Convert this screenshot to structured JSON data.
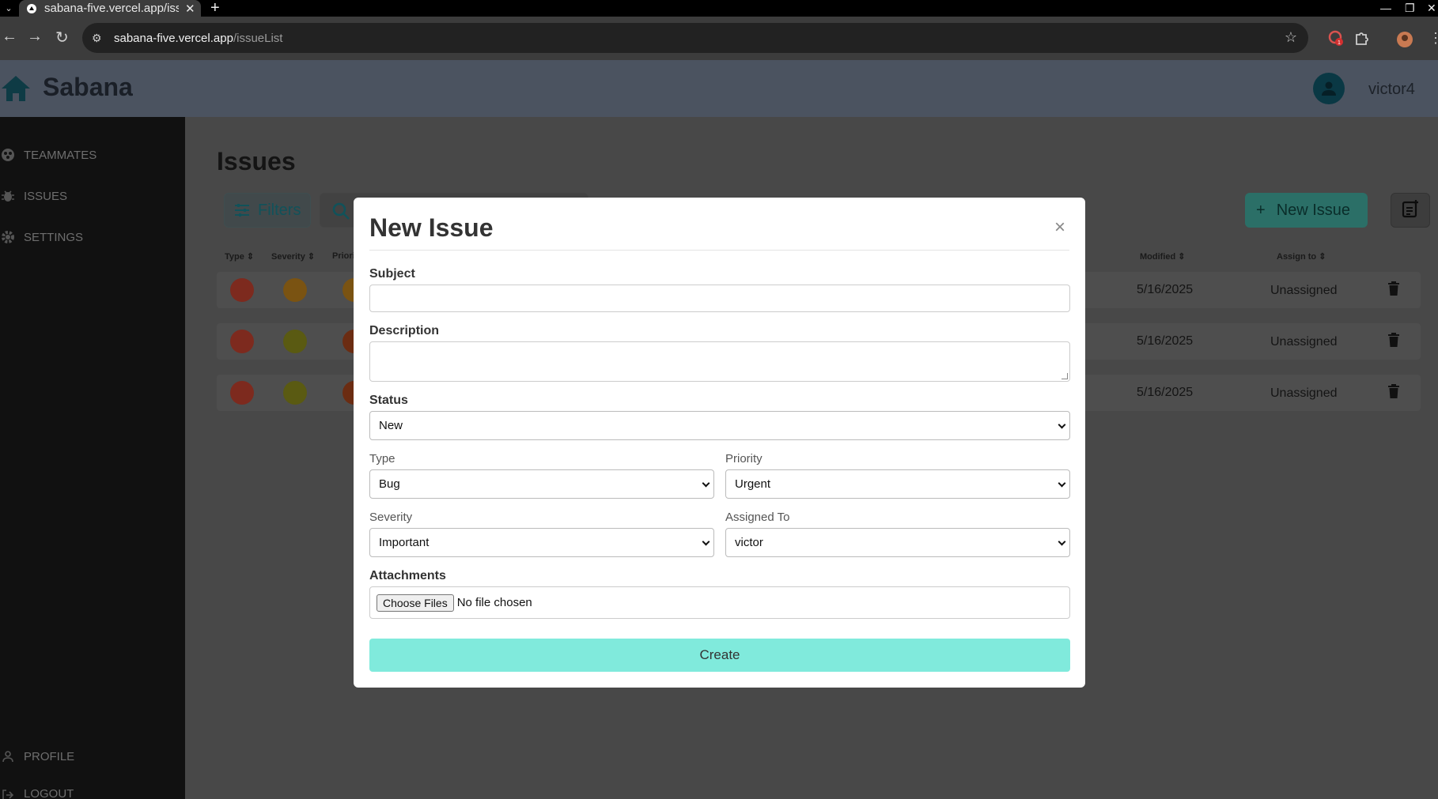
{
  "browser": {
    "tab_title": "sabana-five.vercel.app/issueList",
    "url_host": "sabana-five.vercel.app",
    "url_path": "/issueList",
    "extension_badge": "1"
  },
  "app": {
    "brand": "Sabana",
    "username": "victor4"
  },
  "sidebar": {
    "items": [
      {
        "label": "TEAMMATES",
        "icon": "teammates-icon"
      },
      {
        "label": "ISSUES",
        "icon": "bug-icon"
      },
      {
        "label": "SETTINGS",
        "icon": "gear-icon"
      }
    ],
    "bottom_items": [
      {
        "label": "PROFILE",
        "icon": "person-icon"
      },
      {
        "label": "LOGOUT",
        "icon": "logout-icon"
      }
    ]
  },
  "main": {
    "title": "Issues",
    "filters_label": "Filters",
    "new_issue_label": "New Issue",
    "columns": {
      "type": "Type",
      "severity": "Severity",
      "priority": "Priori",
      "modified": "Modified",
      "assign_to": "Assign to"
    },
    "rows": [
      {
        "type_color": "#7d2a1e",
        "severity_color": "#7a5312",
        "priority_color": "#7a5312",
        "modified": "5/16/2025",
        "assigned": "Unassigned"
      },
      {
        "type_color": "#7d2a1e",
        "severity_color": "#5a5a12",
        "priority_color": "#6b2c12",
        "modified": "5/16/2025",
        "assigned": "Unassigned"
      },
      {
        "type_color": "#7d2a1e",
        "severity_color": "#5a5a12",
        "priority_color": "#6b2c12",
        "modified": "5/16/2025",
        "assigned": "Unassigned"
      }
    ]
  },
  "modal": {
    "title": "New Issue",
    "close": "×",
    "subject_label": "Subject",
    "subject_value": "",
    "description_label": "Description",
    "description_value": "",
    "status_label": "Status",
    "status_value": "New",
    "type_label": "Type",
    "type_value": "Bug",
    "priority_label": "Priority",
    "priority_value": "Urgent",
    "severity_label": "Severity",
    "severity_value": "Important",
    "assigned_label": "Assigned To",
    "assigned_value": "victor",
    "attachments_label": "Attachments",
    "choose_files": "Choose Files",
    "no_file": "No file chosen",
    "create_label": "Create",
    "create_color": "#80eadc"
  }
}
